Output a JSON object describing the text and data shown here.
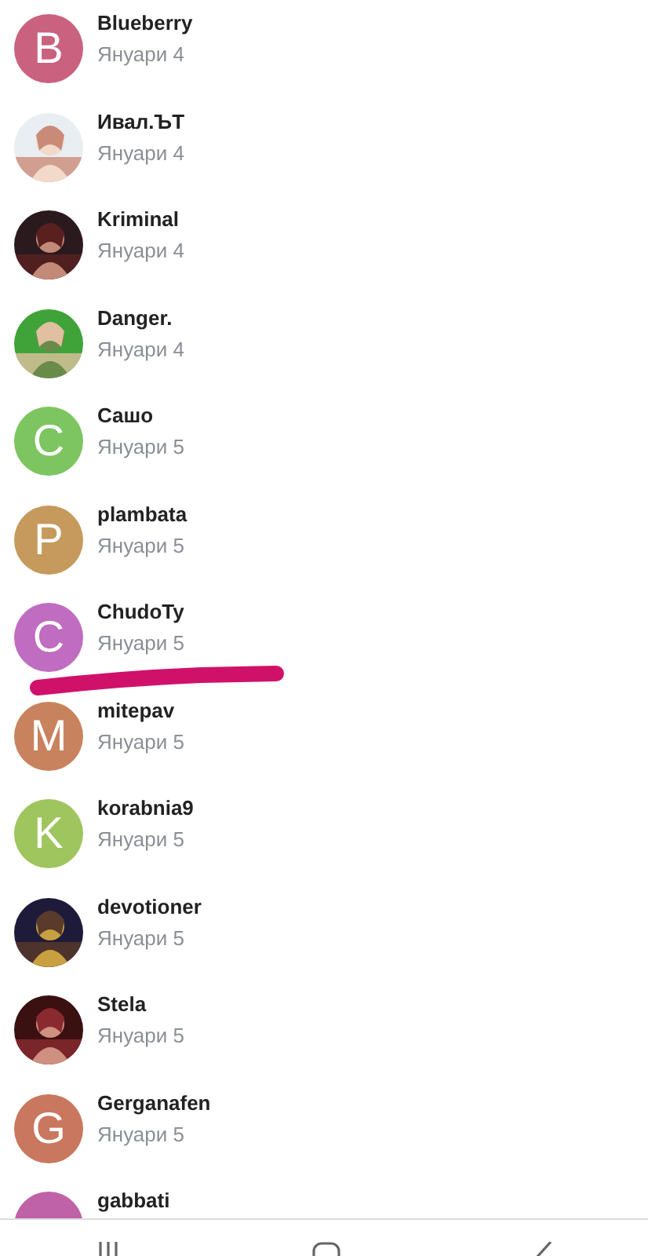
{
  "contacts": [
    {
      "name": "Blueberry",
      "date": "Януари 4",
      "avatar": {
        "kind": "letter",
        "letter": "B",
        "color": "#c9617f"
      }
    },
    {
      "name": "Ивал.ЪТ",
      "date": "Януари 4"
    },
    {
      "name": "Kriminal",
      "date": "Януари 4"
    },
    {
      "name": "Danger.",
      "date": "Януари 4"
    },
    {
      "name": "Сашо",
      "date": "Януари 5",
      "avatar": {
        "kind": "letter",
        "letter": "C",
        "color": "#7dc560"
      }
    },
    {
      "name": "plambata",
      "date": "Януари 5",
      "avatar": {
        "kind": "letter",
        "letter": "P",
        "color": "#c59a5c"
      }
    },
    {
      "name": "ChudoTy",
      "date": "Януари 5",
      "avatar": {
        "kind": "letter",
        "letter": "C",
        "color": "#c06cc0"
      }
    },
    {
      "name": "mitepav",
      "date": "Януари 5",
      "avatar": {
        "kind": "letter",
        "letter": "M",
        "color": "#c8835e"
      }
    },
    {
      "name": "korabnia9",
      "date": "Януари 5",
      "avatar": {
        "kind": "letter",
        "letter": "K",
        "color": "#9fc55e"
      }
    },
    {
      "name": "devotioner",
      "date": "Януари 5"
    },
    {
      "name": "Stela",
      "date": "Януари 5"
    },
    {
      "name": "Gerganafen",
      "date": "Януари 5",
      "avatar": {
        "kind": "letter",
        "letter": "G",
        "color": "#c9775f"
      }
    },
    {
      "name": "gabbati",
      "avatar": {
        "kind": "letter",
        "color": "#c062a8"
      }
    }
  ]
}
